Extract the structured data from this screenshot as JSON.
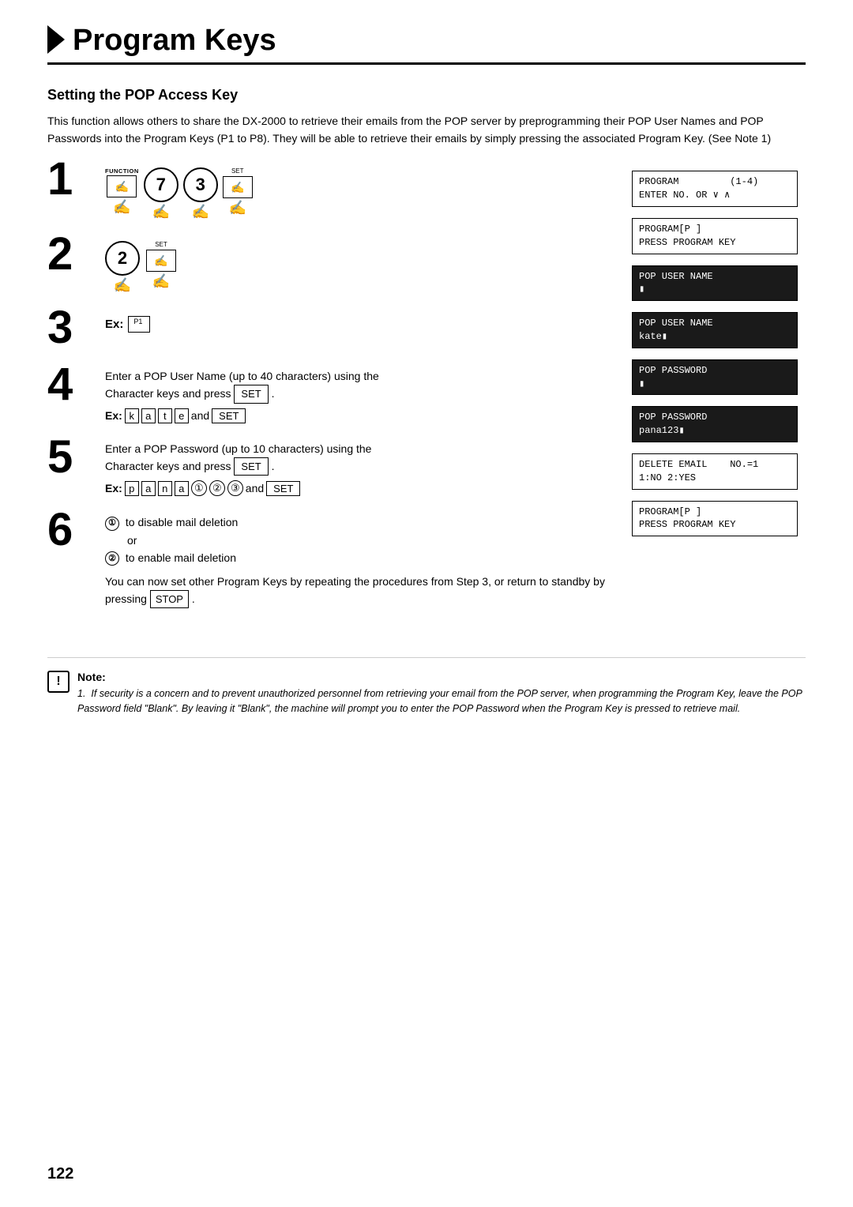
{
  "header": {
    "title": "Program Keys"
  },
  "section": {
    "title": "Setting the POP Access Key",
    "intro": "This function allows others to share the DX-2000 to retrieve their emails from the POP server by preprogramming their POP User Names and POP Passwords into the Program Keys (P1 to P8).  They will be able to retrieve their emails by simply pressing the associated Program Key. (See Note 1)"
  },
  "steps": [
    {
      "number": "1",
      "keys": [
        "FUNCTION",
        "7",
        "3",
        "SET"
      ]
    },
    {
      "number": "2",
      "keys": [
        "2",
        "SET"
      ]
    },
    {
      "number": "3",
      "ex_label": "Ex:",
      "ex_value": "P1"
    },
    {
      "number": "4",
      "text1": "Enter a POP User Name (up to 40 characters) using the",
      "text2": "Character keys and press",
      "set_label": "SET",
      "ex_label": "Ex:",
      "ex_chars": [
        "k",
        "a",
        "t",
        "e"
      ],
      "ex_and": "and",
      "ex_set": "SET"
    },
    {
      "number": "5",
      "text1": "Enter a POP Password (up to 10 characters) using the",
      "text2": "Character keys and press",
      "set_label": "SET",
      "ex_label": "Ex:",
      "ex_chars": [
        "p",
        "a",
        "n",
        "a",
        "①",
        "②",
        "③"
      ],
      "ex_and": "and",
      "ex_set": "SET"
    },
    {
      "number": "6",
      "option1": "to disable mail deletion",
      "or_text": "or",
      "option2": "to enable mail deletion",
      "para": "You can now set other Program Keys by repeating the procedures from Step 3, or return to standby by pressing",
      "stop": "STOP"
    }
  ],
  "lcd_displays": [
    {
      "line1": "PROGRAM         (1-4)",
      "line2": "ENTER NO. OR V ∧"
    },
    {
      "line1": "PROGRAM[P ]",
      "line2": "PRESS PROGRAM KEY"
    },
    {
      "line1": "POP USER NAME",
      "line2": "■",
      "dark": true
    },
    {
      "line1": "POP USER NAME",
      "line2": "kate■",
      "dark": true
    },
    {
      "line1": "POP PASSWORD",
      "line2": "■",
      "dark": true
    },
    {
      "line1": "POP PASSWORD",
      "line2": "pana123■",
      "dark": true
    },
    {
      "line1": "DELETE EMAIL    NO.=1",
      "line2": "1:NO 2:YES"
    },
    {
      "line1": "PROGRAM[P ]",
      "line2": "PRESS PROGRAM KEY"
    }
  ],
  "note": {
    "icon": "!",
    "title": "Note:",
    "items": [
      "1.  If security is a concern and to prevent unauthorized personnel from retrieving your email from the POP server, when programming the Program Key, leave the POP Password field \"Blank\".  By leaving it \"Blank\", the machine will prompt you to enter the POP Password when the Program Key is pressed to retrieve mail."
    ]
  },
  "page_number": "122"
}
